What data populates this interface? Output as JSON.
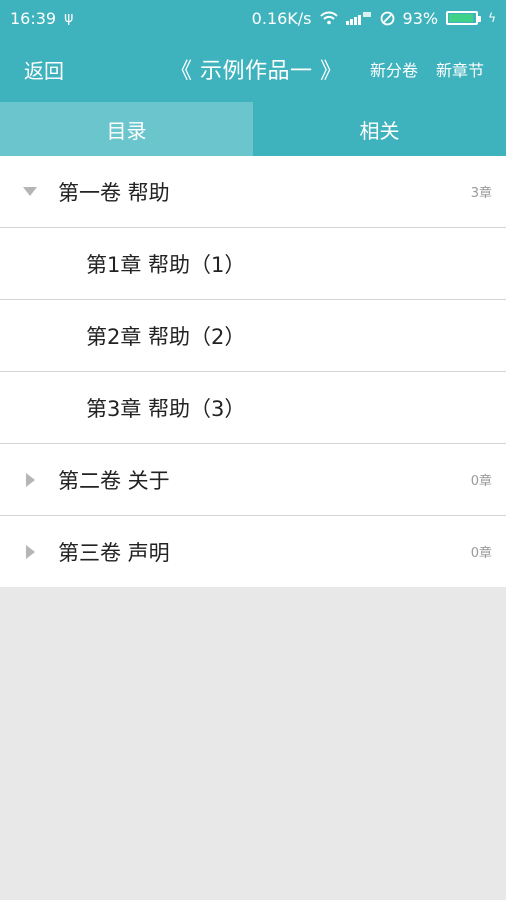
{
  "status": {
    "time": "16:39",
    "net_speed": "0.16K/s",
    "battery_pct": "93%",
    "battery_level": 0.93,
    "icons": [
      "usb-icon",
      "wifi-icon",
      "signal-icon",
      "do-not-disturb-icon",
      "battery-icon",
      "charging-icon"
    ]
  },
  "appbar": {
    "back_label": "返回",
    "title": "《 示例作品一 》",
    "new_volume_label": "新分卷",
    "new_chapter_label": "新章节"
  },
  "tabs": [
    {
      "label": "目录",
      "active": true
    },
    {
      "label": "相关",
      "active": false
    }
  ],
  "list": [
    {
      "type": "volume",
      "label": "第一卷 帮助",
      "count": "3章",
      "expanded": true
    },
    {
      "type": "chapter",
      "label": "第1章 帮助（1）"
    },
    {
      "type": "chapter",
      "label": "第2章 帮助（2）"
    },
    {
      "type": "chapter",
      "label": "第3章 帮助（3）"
    },
    {
      "type": "volume",
      "label": "第二卷 关于",
      "count": "0章",
      "expanded": false
    },
    {
      "type": "volume",
      "label": "第三卷 声明",
      "count": "0章",
      "expanded": false
    }
  ],
  "colors": {
    "primary": "#3fb3bd",
    "tab_active": "#6ac6cc",
    "background": "#e8e8e8",
    "battery_fill": "#41d28a"
  }
}
